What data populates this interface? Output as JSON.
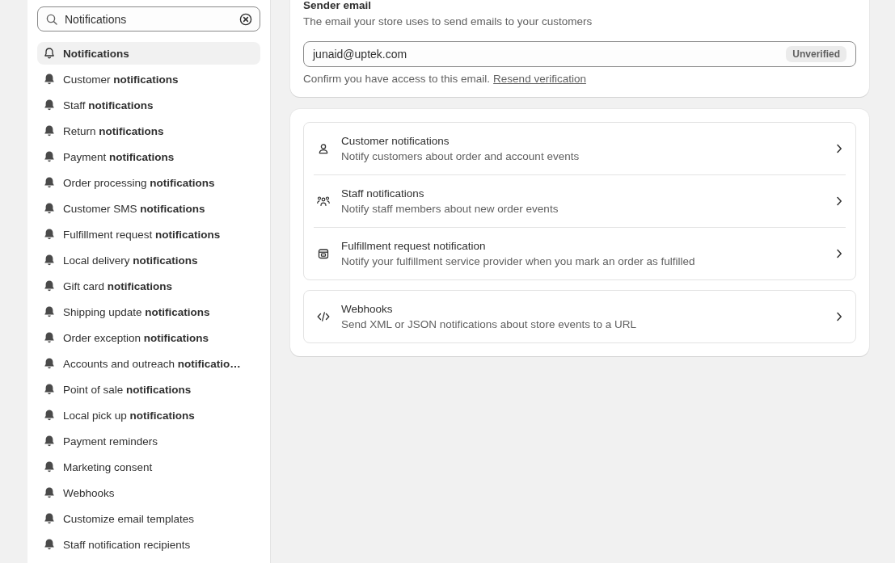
{
  "sidebar": {
    "search": {
      "value": "Notifications"
    },
    "items": [
      {
        "label": "Notifications",
        "selected": true
      },
      {
        "label": "Customer **notifications**",
        "selected": false
      },
      {
        "label": "Staff **notifications**",
        "selected": false
      },
      {
        "label": "Return **notifications**",
        "selected": false
      },
      {
        "label": "Payment **notifications**",
        "selected": false
      },
      {
        "label": "Order processing **notifications**",
        "selected": false
      },
      {
        "label": "Customer SMS **notifications**",
        "selected": false
      },
      {
        "label": "Fulfillment request **notifications**",
        "selected": false
      },
      {
        "label": "Local delivery **notifications**",
        "selected": false
      },
      {
        "label": "Gift card **notifications**",
        "selected": false
      },
      {
        "label": "Shipping update **notifications**",
        "selected": false
      },
      {
        "label": "Order exception **notifications**",
        "selected": false
      },
      {
        "label": "Accounts and outreach **notificatio…**",
        "selected": false
      },
      {
        "label": "Point of sale **notifications**",
        "selected": false
      },
      {
        "label": "Local pick up **notifications**",
        "selected": false
      },
      {
        "label": "Payment reminders",
        "selected": false
      },
      {
        "label": "Marketing consent",
        "selected": false
      },
      {
        "label": "Webhooks",
        "selected": false
      },
      {
        "label": "Customize email templates",
        "selected": false
      },
      {
        "label": "Staff notification recipients",
        "selected": false
      }
    ]
  },
  "sender_email": {
    "title": "Sender email",
    "description": "The email your store uses to send emails to your customers",
    "value": "junaid@uptek.com",
    "badge": "Unverified",
    "help": "Confirm you have access to this email.",
    "link": "Resend verification"
  },
  "groups": [
    [
      {
        "kind": "person",
        "title": "Customer notifications",
        "description": "Notify customers about order and account events"
      },
      {
        "kind": "people",
        "title": "Staff notifications",
        "description": "Notify staff members about new order events"
      },
      {
        "kind": "store",
        "title": "Fulfillment request notification",
        "description": "Notify your fulfillment service provider when you mark an order as fulfilled"
      }
    ],
    [
      {
        "kind": "code",
        "title": "Webhooks",
        "description": "Send XML or JSON notifications about store events to a URL"
      }
    ]
  ]
}
